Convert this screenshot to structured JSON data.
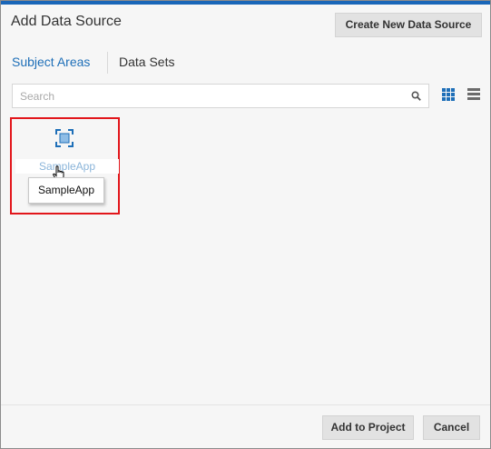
{
  "dialog": {
    "title": "Add Data Source",
    "create_button": "Create New Data Source"
  },
  "tabs": [
    {
      "label": "Subject Areas",
      "active": true
    },
    {
      "label": "Data Sets",
      "active": false
    }
  ],
  "search": {
    "placeholder": "Search",
    "value": "",
    "icon": "magnifier-icon"
  },
  "view_toggle": {
    "grid_icon": "grid-view-icon",
    "list_icon": "list-view-icon",
    "selected": "grid"
  },
  "items": [
    {
      "label": "SampleApp",
      "icon": "subject-area-icon",
      "tooltip": "SampleApp",
      "highlighted": true
    }
  ],
  "footer": {
    "add_button": "Add to Project",
    "cancel_button": "Cancel"
  },
  "colors": {
    "accent_bar": "#1a66b8",
    "active_tab": "#1e6fb8",
    "highlight_border": "#e2161b",
    "icon_blue": "#1e6fb8"
  }
}
